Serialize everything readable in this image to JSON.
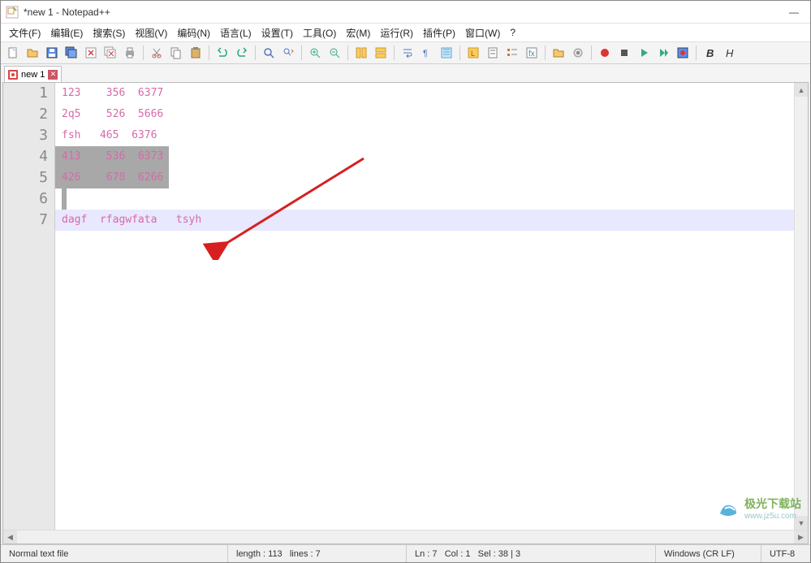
{
  "window": {
    "title": "*new 1 - Notepad++"
  },
  "menu": {
    "file": "文件(F)",
    "edit": "编辑(E)",
    "search": "搜索(S)",
    "view": "视图(V)",
    "encoding": "编码(N)",
    "language": "语言(L)",
    "settings": "设置(T)",
    "tools": "工具(O)",
    "macro": "宏(M)",
    "run": "运行(R)",
    "plugins": "插件(P)",
    "window": "窗口(W)",
    "help": "?"
  },
  "toolbar_icons": [
    "new-file-icon",
    "open-file-icon",
    "save-icon",
    "save-all-icon",
    "close-icon",
    "close-all-icon",
    "print-icon",
    "sep",
    "cut-icon",
    "copy-icon",
    "paste-icon",
    "sep",
    "undo-icon",
    "redo-icon",
    "sep",
    "find-icon",
    "replace-icon",
    "sep",
    "zoom-in-icon",
    "zoom-out-icon",
    "sep",
    "sync-v-icon",
    "sync-h-icon",
    "sep",
    "wrap-icon",
    "hidden-chars-icon",
    "indent-guide-icon",
    "sep",
    "udl-icon",
    "doc-map-icon",
    "doc-list-icon",
    "func-list-icon",
    "sep",
    "folder-icon",
    "monitor-icon",
    "sep",
    "record-icon",
    "stop-icon",
    "play-icon",
    "playback-icon",
    "save-macro-icon",
    "sep",
    "bold-icon",
    "italic-icon"
  ],
  "tabs": [
    {
      "label": "new 1",
      "modified": true
    }
  ],
  "editor": {
    "lines": [
      {
        "num": "1",
        "text": "123    356  6377",
        "sel": false
      },
      {
        "num": "2",
        "text": "2q5    526  5666",
        "sel": false
      },
      {
        "num": "3",
        "text": "fsh   465  6376",
        "sel": false
      },
      {
        "num": "4",
        "text": "413    536  6373",
        "sel": true,
        "sel_width": 140
      },
      {
        "num": "5",
        "text": "426    678  6266",
        "sel": true,
        "sel_width": 140
      },
      {
        "num": "6",
        "text": "",
        "sel": false,
        "caret_block": true
      },
      {
        "num": "7",
        "text": "dagf  rfagwfata   tsyh",
        "sel": false,
        "current": true
      }
    ]
  },
  "status": {
    "file_type": "Normal text file",
    "length": "length : 113",
    "lines": "lines : 7",
    "ln": "Ln : 7",
    "col": "Col : 1",
    "sel": "Sel : 38 | 3",
    "eol": "Windows (CR LF)",
    "encoding": "UTF-8"
  },
  "watermark": {
    "text": "极光下载站",
    "url": "www.jz5u.com"
  },
  "colors": {
    "code_text": "#d66aa8",
    "selection_bg": "#a8a8a8",
    "current_line": "#e8e8ff",
    "arrow": "#d72020"
  }
}
